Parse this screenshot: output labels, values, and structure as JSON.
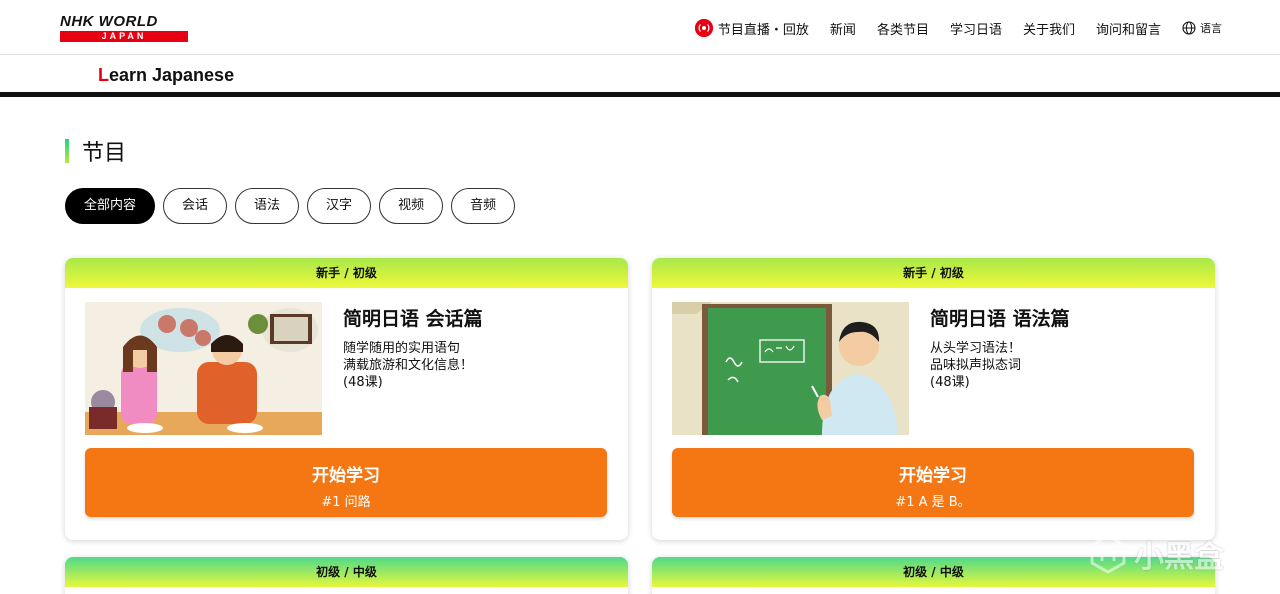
{
  "header": {
    "logo_top": "NHK WORLD",
    "logo_bottom": "JAPAN",
    "nav": [
      "节目直播・回放",
      "新闻",
      "各类节目",
      "学习日语",
      "关于我们",
      "询问和留言",
      "语言"
    ]
  },
  "subheader": {
    "title_first": "L",
    "title_rest": "earn Japanese"
  },
  "section": {
    "title": "节目",
    "filters": [
      "全部内容",
      "会话",
      "语法",
      "汉字",
      "视频",
      "音频"
    ],
    "active_filter": "全部内容"
  },
  "cards": [
    {
      "level": "新手 / 初级",
      "title": "简明日语 会话篇",
      "desc": [
        "随学随用的实用语句",
        "满载旅游和文化信息！",
        "(48课)"
      ],
      "button_label": "开始学习",
      "button_sub": "#1 问路"
    },
    {
      "level": "新手 / 初级",
      "title": "简明日语 语法篇",
      "desc": [
        "从头学习语法！",
        "品味拟声拟态词",
        "(48课)"
      ],
      "button_label": "开始学习",
      "button_sub": "#1 A 是 B。"
    },
    {
      "level": "初级 / 中级"
    },
    {
      "level": "初级 / 中级"
    }
  ],
  "watermark": "小黑盒",
  "colors": {
    "brand_red": "#e60012",
    "button_orange": "#f47714",
    "head_gradient_top": "#4ed98a",
    "head_gradient_bottom": "#e6f73a"
  }
}
